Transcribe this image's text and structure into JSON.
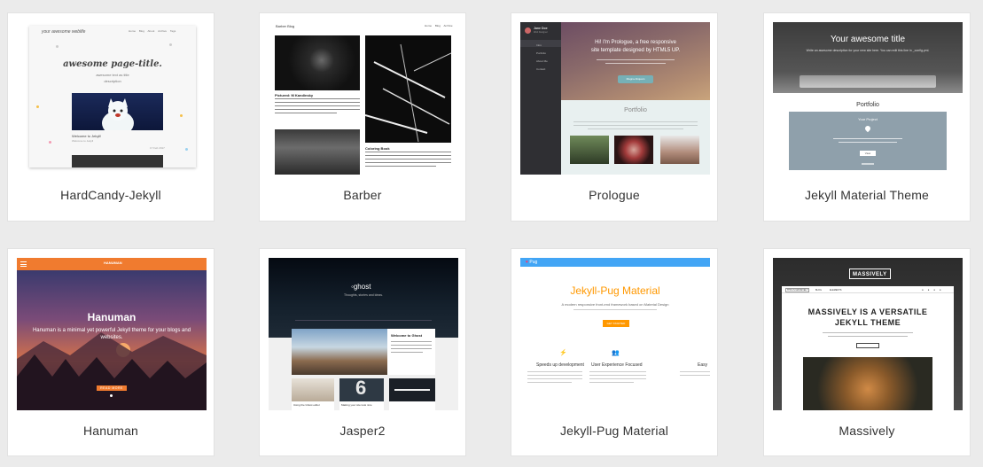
{
  "cards": [
    {
      "title": "HardCandy-Jekyll",
      "preview": {
        "blog_name": "your awesome weblife",
        "nav": [
          "Home",
          "Blog",
          "About",
          "Archive",
          "Tags"
        ],
        "page_title": "awesome page-title.",
        "subtitle": "awesome text as title",
        "desc": "description",
        "post_title": "Welcome to Jekyll!",
        "post_meta": "Welcome to Jekyll",
        "date": "17 Feb 2017"
      }
    },
    {
      "title": "Barber",
      "preview": {
        "site": "Barber Blog",
        "nav": [
          "Home",
          "Blog",
          "Archive"
        ],
        "caption1": "Pictured: M Kandinsky",
        "caption2": "Coloring Book"
      }
    },
    {
      "title": "Prologue",
      "preview": {
        "name": "Jane Doe",
        "role": "Web Designer",
        "menu": [
          "Intro",
          "Portfolio",
          "About Me",
          "Contact"
        ],
        "hero_line1": "Hi! I'm Prologue, a free responsive",
        "hero_line2": "site template designed by HTML5 UP.",
        "hero_btn": "Magna Aliquam",
        "portfolio": "Portfolio"
      }
    },
    {
      "title": "Jekyll Material Theme",
      "preview": {
        "hero": "Your awesome title",
        "hero_text": "Write an awesome description for your new site here. You can edit this line in _config.yml.",
        "section": "Portfolio",
        "project": "Your Project",
        "view": "View"
      }
    },
    {
      "title": "Hanuman",
      "preview": {
        "brand": "HANUMAN",
        "hero": "Hanuman",
        "text": "Hanuman is a minimal yet powerful Jekyll theme for your blogs and websites.",
        "btn": "READ MORE"
      }
    },
    {
      "title": "Jasper2",
      "preview": {
        "logo": "ghost",
        "tagline": "Thoughts, stories and ideas.",
        "post1": "Welcome to Ghost",
        "tile1": "Using the Ghost editor",
        "tile2": "Making your site look nice"
      }
    },
    {
      "title": "Jekyll-Pug Material",
      "preview": {
        "nav_label": "Pug",
        "hero": "Jekyll-Pug Material",
        "sub": "A modern responsive front-end framework based on Material Design",
        "btn": "GET STARTED",
        "f1": "Speeds up development",
        "f2": "User Experience Focused",
        "f3": "Easy"
      }
    },
    {
      "title": "Massively",
      "preview": {
        "logo": "MASSIVELY",
        "nav": [
          "THIS IS MASSIVELY",
          "BLOG",
          "ELEMENTS"
        ],
        "hero1": "MASSIVELY IS A VERSATILE",
        "hero2": "JEKYLL THEME"
      }
    }
  ],
  "colors": {
    "background": "#ebebeb",
    "card": "#ffffff",
    "title_text": "#333333",
    "hanuman_orange": "#f07b2f",
    "pug_blue": "#42a5f5",
    "pug_orange": "#ff9800",
    "material_slate": "#8fa0ab",
    "prologue_sidebar": "#2f2f33"
  }
}
